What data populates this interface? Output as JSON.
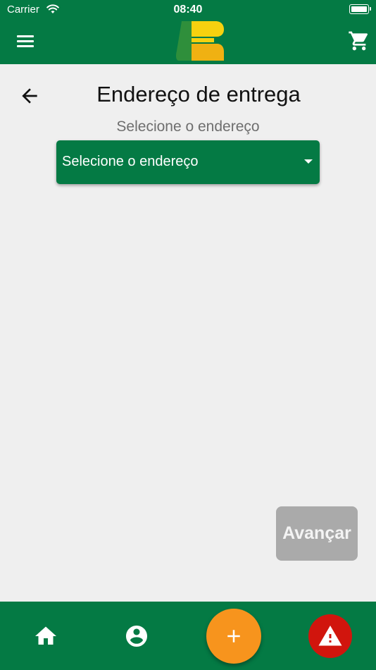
{
  "status_bar": {
    "carrier": "Carrier",
    "time": "08:40"
  },
  "header": {
    "menu_icon": "hamburger-menu-icon",
    "logo": "brand-logo",
    "cart_icon": "shopping-cart-icon"
  },
  "page": {
    "title": "Endereço de entrega",
    "back_icon": "arrow-left-icon",
    "address_label": "Selecione o endereço",
    "address_dropdown": {
      "selected": "Selecione o endereço"
    },
    "next_button": "Avançar"
  },
  "bottom_nav": {
    "items": [
      {
        "icon": "home-icon"
      },
      {
        "icon": "account-circle-icon"
      },
      {
        "icon": "plus-icon"
      },
      {
        "icon": "warning-icon"
      }
    ]
  },
  "colors": {
    "brand_green": "#047a44",
    "background": "#efefef",
    "disabled_button": "#aaaaaa",
    "add_fab": "#f7941d",
    "alert_fab": "#d1150d",
    "logo_yellow": "#f6d10f",
    "logo_orange": "#f0b112",
    "logo_green": "#2f8f3b"
  }
}
